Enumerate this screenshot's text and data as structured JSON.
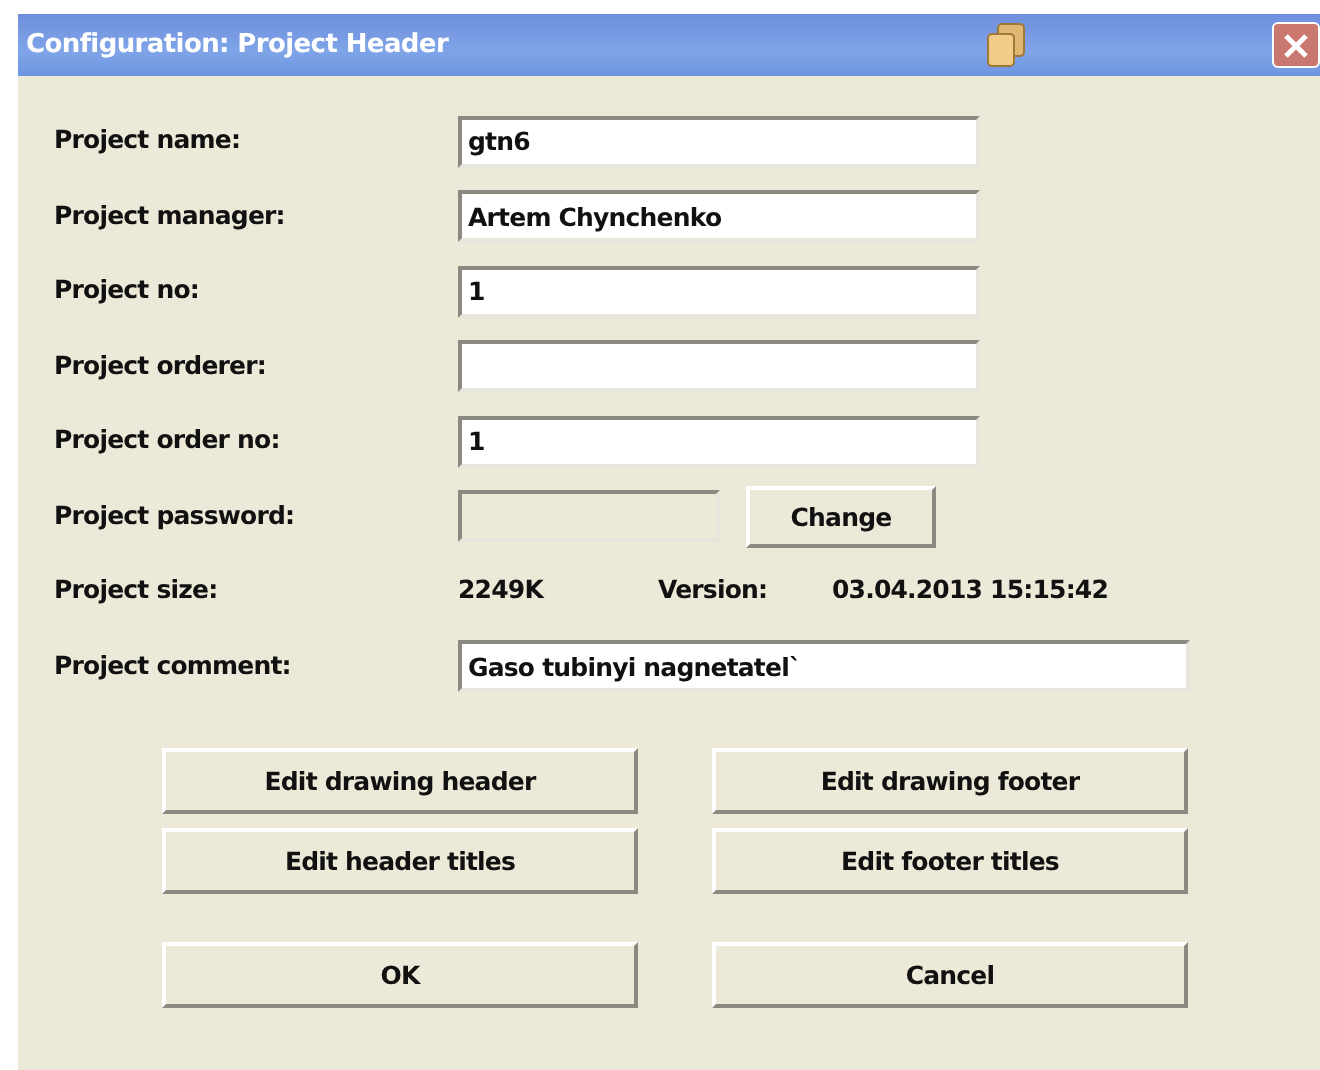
{
  "window": {
    "title": "Configuration: Project Header"
  },
  "rows": [
    {
      "kind": "text",
      "label": "Project name:",
      "value": "gtn6"
    },
    {
      "kind": "text",
      "label": "Project manager:",
      "value": "Artem Chynchenko"
    },
    {
      "kind": "text",
      "label": "Project no:",
      "value": "1"
    },
    {
      "kind": "text",
      "label": "Project orderer:",
      "value": ""
    },
    {
      "kind": "text",
      "label": "Project order no:",
      "value": "1"
    },
    {
      "kind": "password",
      "label": "Project password:",
      "disabled": true,
      "button": "Change"
    },
    {
      "kind": "info",
      "label": "Project size:",
      "value": "2249K",
      "version_label": "Version:",
      "version": "03.04.2013 15:15:42"
    },
    {
      "kind": "wide",
      "label": "Project comment:",
      "value": "Gaso tubinyi nagnetatel`"
    }
  ],
  "action_buttons": [
    [
      "Edit drawing header",
      "Edit drawing footer"
    ],
    [
      "Edit header titles",
      "Edit footer titles"
    ]
  ],
  "dialog_buttons": [
    "OK",
    "Cancel"
  ]
}
